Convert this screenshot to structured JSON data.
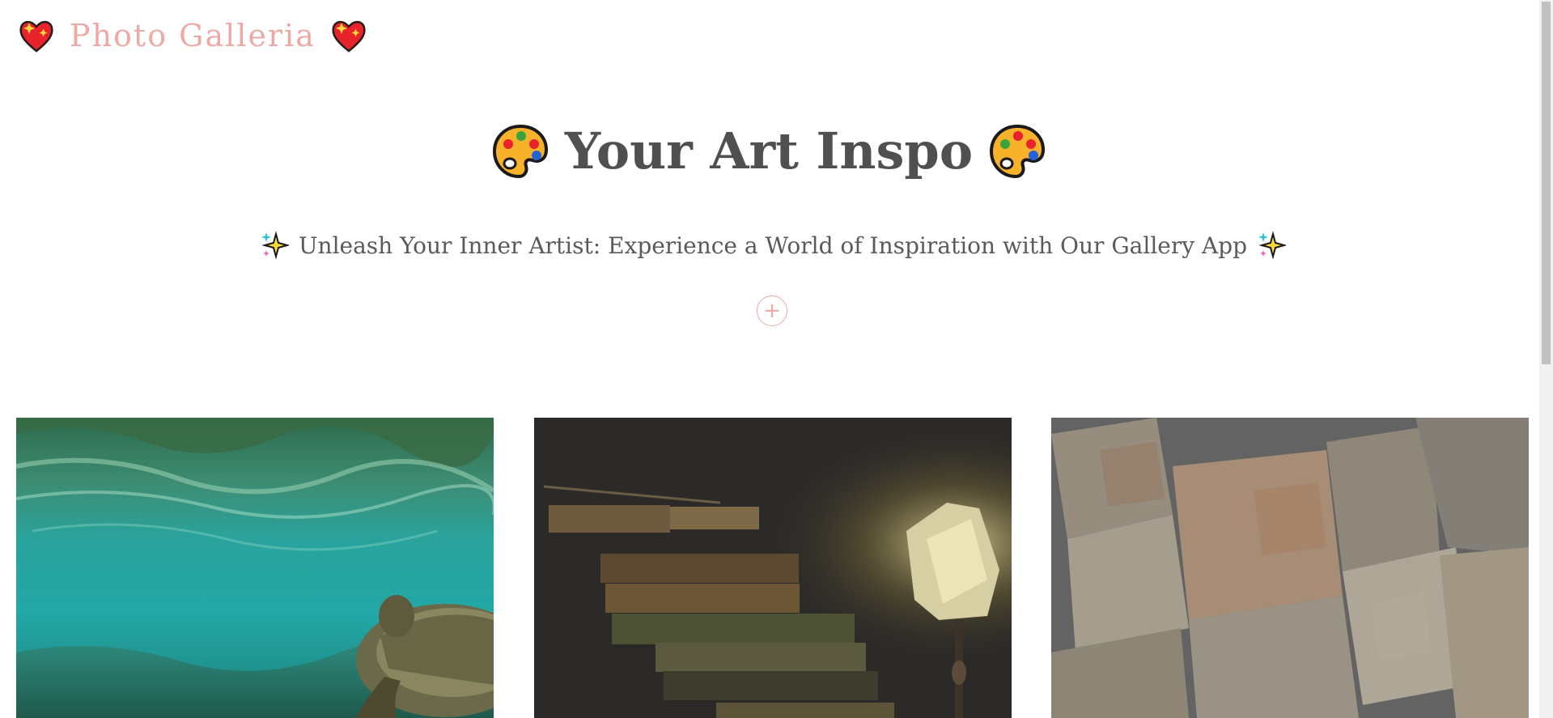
{
  "header": {
    "brand_title": "Photo Galleria",
    "brand_icon_left": "sparkling-heart-icon",
    "brand_icon_right": "sparkling-heart-icon",
    "brand_color": "#eca9a6"
  },
  "hero": {
    "title": "Your Art Inspo",
    "title_icon": "artist-palette-icon",
    "subtitle": "Unleash Your Inner Artist: Experience a World of Inspiration with Our Gallery App",
    "subtitle_icon": "sparkles-icon",
    "add_button_label": "+"
  },
  "gallery": {
    "items": [
      {
        "subject": "sea turtle underwater",
        "icon": "photo-turtle"
      },
      {
        "subject": "stack of old books beside lamp",
        "icon": "photo-books"
      },
      {
        "subject": "scattered old maps",
        "icon": "photo-maps"
      }
    ]
  }
}
